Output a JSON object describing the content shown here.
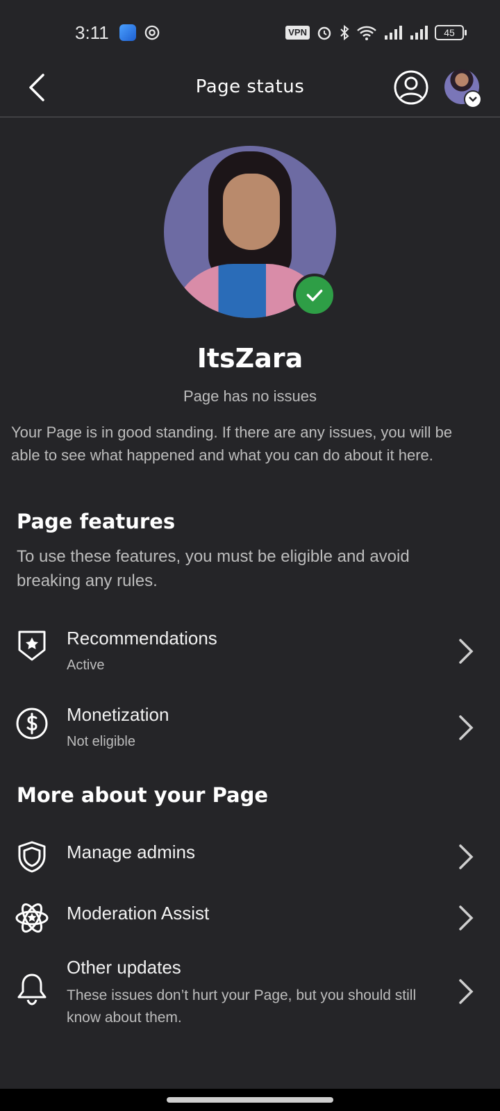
{
  "status_bar": {
    "time": "3:11",
    "vpn_label": "VPN",
    "battery_level": "45",
    "icons": [
      "app-icon",
      "chrome-icon",
      "vpn-icon",
      "alarm-icon",
      "bluetooth-icon",
      "wifi-icon",
      "signal-icon",
      "signal-icon",
      "battery-icon"
    ]
  },
  "header": {
    "title": "Page status",
    "back_icon": "back-arrow-icon",
    "account_icon": "user-circle-icon"
  },
  "profile": {
    "name": "ItsZara",
    "status": "Page has no issues",
    "description": "Your Page is in good standing. If there are any issues, you will be able to see what happened and what you can do about it here.",
    "verified_color": "#2e9e46"
  },
  "features": {
    "title": "Page features",
    "description": "To use these features, you must be eligible and avoid breaking any rules.",
    "items": [
      {
        "label": "Recommendations",
        "sub": "Active",
        "icon": "shield-star-icon"
      },
      {
        "label": "Monetization",
        "sub": "Not eligible",
        "icon": "dollar-circle-icon"
      }
    ]
  },
  "more": {
    "title": "More about your Page",
    "items": [
      {
        "label": "Manage admins",
        "icon": "shield-icon"
      },
      {
        "label": "Moderation Assist",
        "icon": "atom-star-icon"
      },
      {
        "label": "Other updates",
        "sub": "These issues don’t hurt your Page, but you should still know about them.",
        "icon": "bell-icon"
      }
    ]
  }
}
